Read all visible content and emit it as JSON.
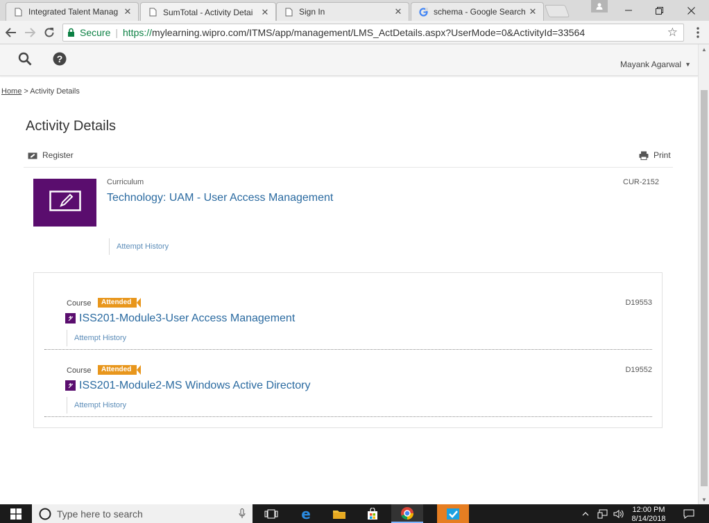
{
  "browser": {
    "tabs": [
      {
        "title": "Integrated Talent Manag",
        "icon": "page-icon",
        "active": false
      },
      {
        "title": "SumTotal - Activity Detai",
        "icon": "page-icon",
        "active": true
      },
      {
        "title": "Sign In",
        "icon": "page-icon",
        "active": false
      },
      {
        "title": "schema - Google Search",
        "icon": "google-icon",
        "active": false
      }
    ],
    "secure_label": "Secure",
    "url_scheme": "https://",
    "url_rest": "mylearning.wipro.com/ITMS/app/management/LMS_ActDetails.aspx?UserMode=0&ActivityId=33564"
  },
  "header": {
    "user_name": "Mayank Agarwal"
  },
  "breadcrumb": {
    "home": "Home",
    "separator": ">",
    "current": "Activity Details"
  },
  "page": {
    "title": "Activity Details",
    "register_label": "Register",
    "print_label": "Print"
  },
  "curriculum": {
    "type": "Curriculum",
    "title": "Technology: UAM - User Access Management",
    "code": "CUR-2152",
    "attempt_history": "Attempt History"
  },
  "courses": [
    {
      "type": "Course",
      "status": "Attended",
      "title": "ISS201-Module3-User Access Management",
      "code": "D19553",
      "attempt_history": "Attempt History"
    },
    {
      "type": "Course",
      "status": "Attended",
      "title": "ISS201-Module2-MS Windows Active Directory",
      "code": "D19552",
      "attempt_history": "Attempt History"
    }
  ],
  "taskbar": {
    "search_placeholder": "Type here to search",
    "time": "12:00 PM",
    "date": "8/14/2018"
  },
  "colors": {
    "accent_purple": "#5a0d6e",
    "link_blue": "#2a6aa0",
    "badge_orange": "#e8961c",
    "secure_green": "#0b8043"
  }
}
